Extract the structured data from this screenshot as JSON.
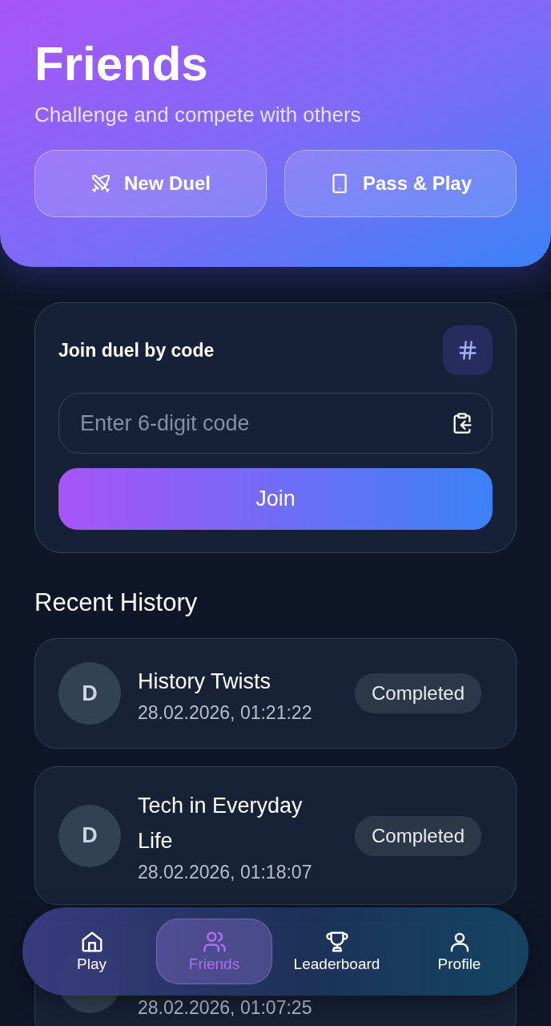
{
  "header": {
    "title": "Friends",
    "subtitle": "Challenge and compete with others",
    "actions": [
      {
        "kind": "swords",
        "label": "New Duel"
      },
      {
        "kind": "phone",
        "label": "Pass & Play"
      }
    ]
  },
  "join": {
    "title": "Join duel by code",
    "placeholder": "Enter 6-digit code",
    "button": "Join"
  },
  "history": {
    "title": "Recent History",
    "items": [
      {
        "initial": "D",
        "name": "History Twists",
        "date": "28.02.2026, 01:21:22",
        "status": "Completed"
      },
      {
        "initial": "D",
        "name": "Tech in Everyday Life",
        "date": "28.02.2026, 01:18:07",
        "status": "Completed"
      },
      {
        "date": "28.02.2026, 01:07:25"
      }
    ]
  },
  "nav": [
    {
      "kind": "home",
      "label": "Play",
      "selected": false
    },
    {
      "kind": "friends",
      "label": "Friends",
      "selected": true
    },
    {
      "kind": "trophy",
      "label": "Leaderboard",
      "selected": false
    },
    {
      "kind": "user",
      "label": "Profile",
      "selected": false
    }
  ]
}
